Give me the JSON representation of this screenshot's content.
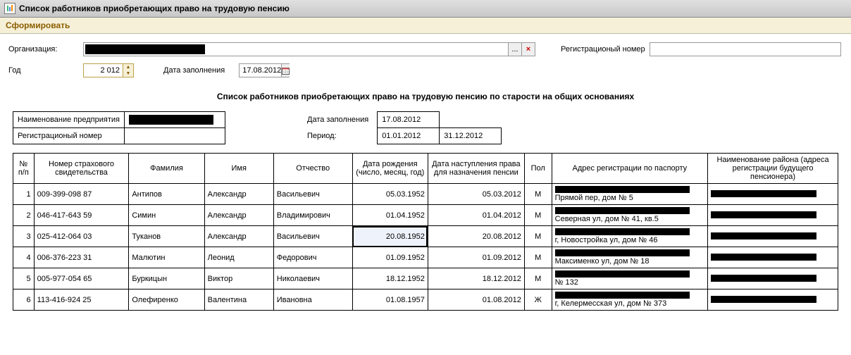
{
  "window": {
    "title": "Список работников приобретающих право на трудовую пенсию"
  },
  "toolbar": {
    "generate": "Сформировать"
  },
  "filters": {
    "org_label": "Организация:",
    "lookup_btn": "...",
    "clear_btn": "×",
    "reg_label": "Регистрационый номер",
    "year_label": "Год",
    "year_value": "2 012",
    "fill_date_label": "Дата заполнения",
    "fill_date_value": "17.08.2012"
  },
  "report": {
    "title": "Список работников приобретающих право на трудовую пенсию по старости на общих основаниях",
    "org_name_label": "Наименование предприятия",
    "reg_label": "Регистрационый номер",
    "fill_date_label": "Дата заполнения",
    "fill_date_value": "17.08.2012",
    "period_label": "Период:",
    "period_from": "01.01.2012",
    "period_to": "31.12.2012"
  },
  "table": {
    "headers": {
      "num": "№ п/п",
      "ins": "Номер страхового свидетельства",
      "fam": "Фамилия",
      "name": "Имя",
      "patr": "Отчество",
      "bd": "Дата рождения (число, месяц, год)",
      "pd": "Дата наступления права для назначения пенсии",
      "sex": "Пол",
      "addr": "Адрес регистрации по паспорту",
      "dist": "Наименование района (адреса регистрации будущего пенсионера)"
    },
    "rows": [
      {
        "n": "1",
        "ins": "009-399-098 87",
        "fam": "Антипов",
        "name": "Александр",
        "patr": "Васильевич",
        "bd": "05.03.1952",
        "pd": "05.03.2012",
        "sex": "М",
        "addr2": "Прямой пер, дом № 5"
      },
      {
        "n": "2",
        "ins": "046-417-643 59",
        "fam": "Симин",
        "name": "Александр",
        "patr": "Владимирович",
        "bd": "01.04.1952",
        "pd": "01.04.2012",
        "sex": "М",
        "addr2": "Северная ул, дом № 41, кв.5"
      },
      {
        "n": "3",
        "ins": "025-412-064 03",
        "fam": "Туканов",
        "name": "Александр",
        "patr": "Васильевич",
        "bd": "20.08.1952",
        "pd": "20.08.2012",
        "sex": "М",
        "addr2": "г, Новостройка ул, дом № 46",
        "selected": true
      },
      {
        "n": "4",
        "ins": "006-376-223 31",
        "fam": "Малютин",
        "name": "Леонид",
        "patr": "Федорович",
        "bd": "01.09.1952",
        "pd": "01.09.2012",
        "sex": "М",
        "addr2": "Максименко ул, дом № 18"
      },
      {
        "n": "5",
        "ins": "005-977-054 65",
        "fam": "Буркицын",
        "name": "Виктор",
        "patr": "Николаевич",
        "bd": "18.12.1952",
        "pd": "18.12.2012",
        "sex": "М",
        "addr2": "№ 132"
      },
      {
        "n": "6",
        "ins": "113-416-924 25",
        "fam": "Олефиренко",
        "name": "Валентина",
        "patr": "Ивановна",
        "bd": "01.08.1957",
        "pd": "01.08.2012",
        "sex": "Ж",
        "addr2": "г, Келермесская ул, дом № 373"
      }
    ]
  }
}
